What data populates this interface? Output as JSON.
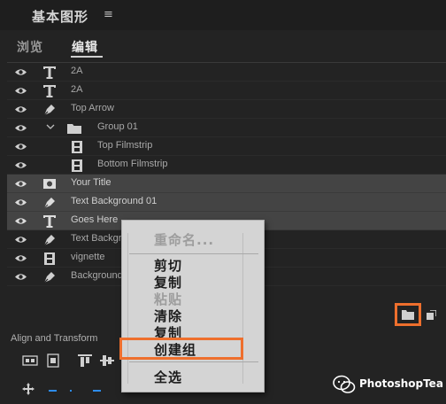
{
  "panel": {
    "title": "基本图形",
    "menu_glyph": "≡"
  },
  "tabs": [
    {
      "label": "浏览"
    },
    {
      "label": "编辑"
    }
  ],
  "layers": [
    {
      "name": "2A",
      "icon": "text-icon",
      "selected": false
    },
    {
      "name": "2A",
      "icon": "text-icon",
      "selected": false
    },
    {
      "name": "Top Arrow",
      "icon": "pen-icon",
      "selected": false
    },
    {
      "name": "Group 01",
      "icon": "folder-icon",
      "selected": false
    },
    {
      "name": "Top Filmstrip",
      "icon": "film-icon",
      "selected": false
    },
    {
      "name": "Bottom Filmstrip",
      "icon": "film-icon",
      "selected": false
    },
    {
      "name": "Your Title",
      "icon": "image-icon",
      "selected": true
    },
    {
      "name": "Text Background 01",
      "icon": "pen-icon",
      "selected": true
    },
    {
      "name": "Goes Here",
      "icon": "text-icon",
      "selected": true
    },
    {
      "name": "Text Backgr",
      "icon": "pen-icon",
      "selected": false
    },
    {
      "name": "vignette",
      "icon": "film-icon",
      "selected": false
    },
    {
      "name": "Background",
      "icon": "pen-icon",
      "selected": false
    }
  ],
  "context_menu": {
    "rename": "重命名...",
    "cut": "剪切",
    "copy": "复制",
    "paste": "粘贴",
    "clear": "清除",
    "duplicate": "复制",
    "create_group": "创建组",
    "select_all": "全选"
  },
  "align_section": {
    "label": "Align and Transform"
  },
  "watermark": {
    "text": "PhotoshopTea"
  },
  "colors": {
    "accent_highlight": "#ee6f2d",
    "blue": "#2d8ceb",
    "panel_bg": "#232323"
  }
}
